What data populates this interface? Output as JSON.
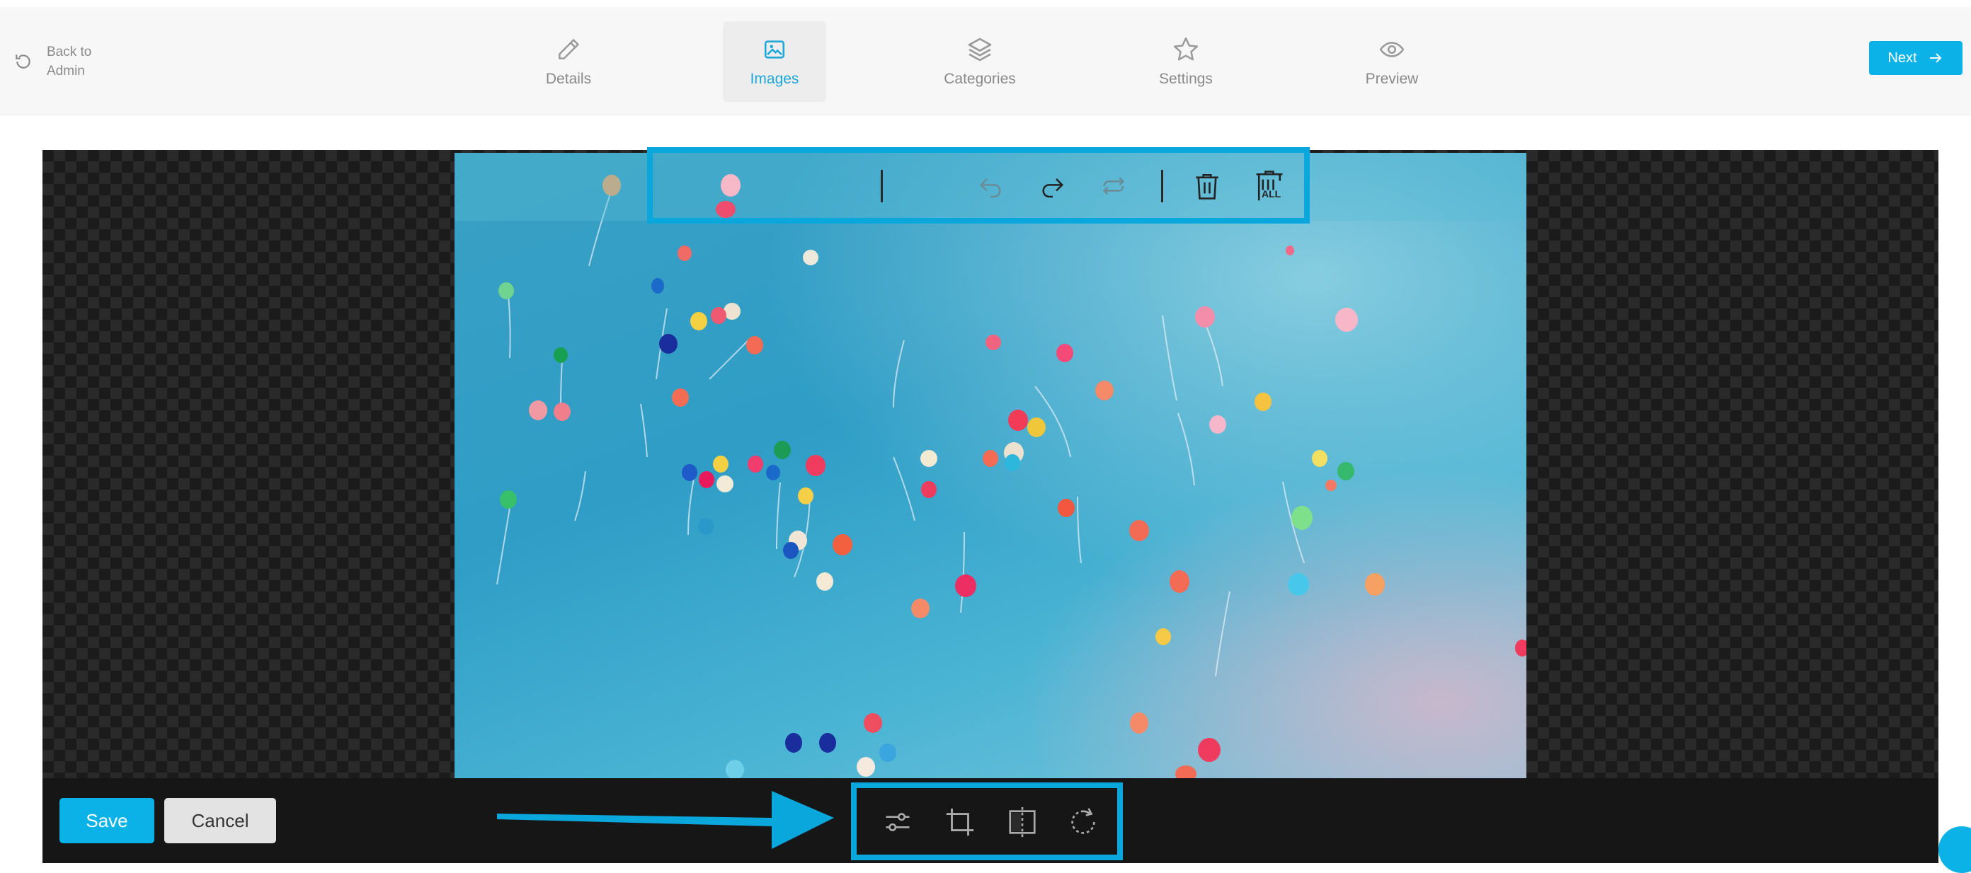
{
  "header": {
    "back_label": "Back to Admin",
    "back_icon": "undo-icon",
    "next_label": "Next",
    "next_icon": "arrow-right-icon",
    "accent_color": "#0ab2e8",
    "tabs": [
      {
        "label": "Details",
        "icon": "pencil-icon",
        "active": false
      },
      {
        "label": "Images",
        "icon": "image-icon",
        "active": true
      },
      {
        "label": "Categories",
        "icon": "layers-icon",
        "active": false
      },
      {
        "label": "Settings",
        "icon": "star-icon",
        "active": false
      },
      {
        "label": "Preview",
        "icon": "eye-icon",
        "active": false
      }
    ]
  },
  "editor": {
    "top_toolbar": [
      "undo-icon",
      "redo-icon",
      "reset-icon",
      "delete-icon",
      "delete-all-icon"
    ],
    "delete_all_text": "ALL",
    "bottom_toolbar": [
      "adjust-sliders-icon",
      "crop-icon",
      "flip-icon",
      "rotate-icon"
    ],
    "save_label": "Save",
    "cancel_label": "Cancel",
    "highlight_color": "#0aa7dc"
  }
}
